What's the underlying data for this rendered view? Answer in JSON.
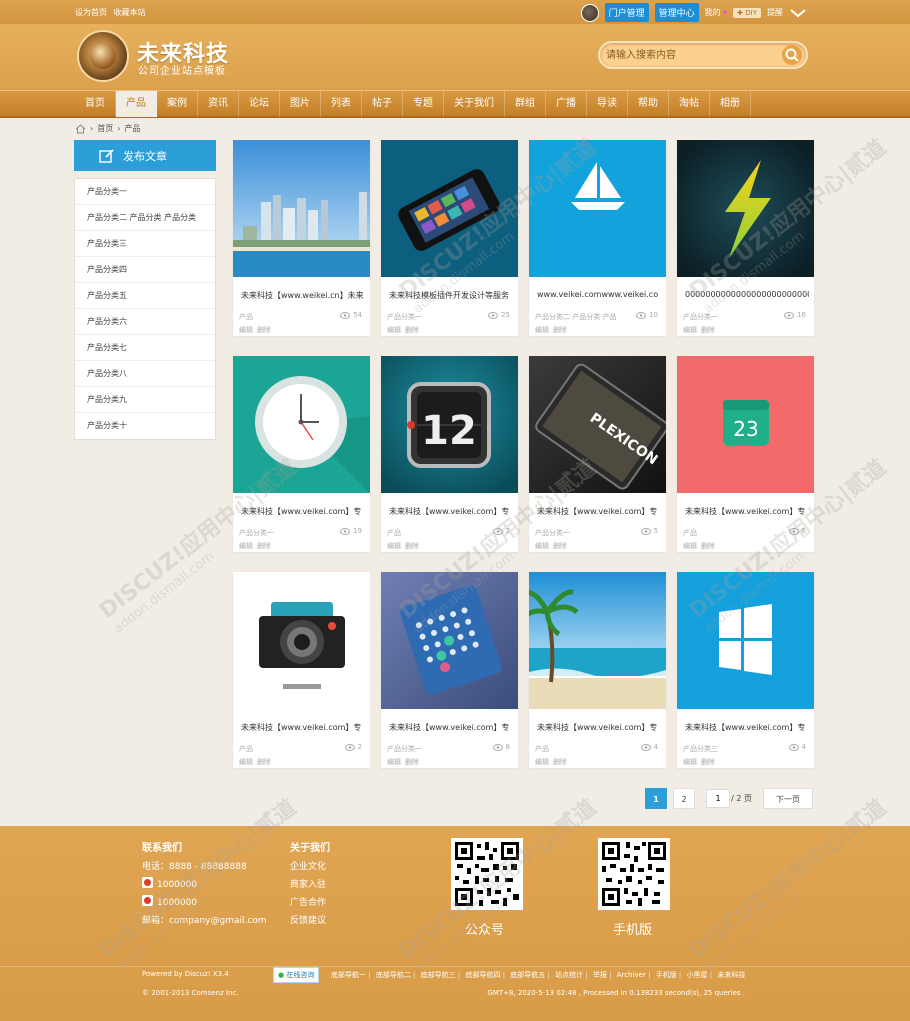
{
  "topbar": {
    "set_home": "设为首页",
    "bookmark": "收藏本站",
    "portal_admin": "门户管理",
    "admin_center": "管理中心",
    "mine": "我的",
    "diy": "DIY",
    "remind": "提醒"
  },
  "header": {
    "logo_title": "未来科技",
    "logo_subtitle": "公司企业站点模板",
    "search_placeholder": "请输入搜索内容"
  },
  "nav": [
    "首页",
    "产品",
    "案例",
    "资讯",
    "论坛",
    "图片",
    "列表",
    "帖子",
    "专题",
    "关于我们",
    "群组",
    "广播",
    "导读",
    "帮助",
    "淘帖",
    "相册"
  ],
  "breadcrumb": [
    "首页",
    "产品"
  ],
  "sidebar": {
    "publish_label": "发布文章",
    "categories": [
      "产品分类一",
      "产品分类二 产品分类 产品分类",
      "产品分类三",
      "产品分类四",
      "产品分类五",
      "产品分类六",
      "产品分类七",
      "产品分类八",
      "产品分类九",
      "产品分类十"
    ]
  },
  "cards": [
    {
      "title": "未来科技【www.weikei.cn】未来",
      "category": "产品",
      "views": "54",
      "edit": "编辑",
      "delete": "删除",
      "image": "city-skyline-image"
    },
    {
      "title": "未来科技模板插件开发设计等服务",
      "category": "产品分类一",
      "views": "25",
      "edit": "编辑",
      "delete": "删除",
      "image": "smartphone-image"
    },
    {
      "title": "www.veikei.comwww.veikei.co",
      "category": "产品分类二 产品分类 产品",
      "views": "10",
      "edit": "编辑",
      "delete": "删除",
      "image": "sailboat-image"
    },
    {
      "title": "000000000000000000000000000",
      "category": "产品分类一",
      "views": "16",
      "edit": "编辑",
      "delete": "删除",
      "image": "lightning-image"
    },
    {
      "title": "未来科技【www.veikei.com】专",
      "category": "产品分类一",
      "views": "19",
      "edit": "编辑",
      "delete": "删除",
      "image": "clock-image"
    },
    {
      "title": "未来科技【www.veikei.com】专",
      "category": "产品",
      "views": "2",
      "edit": "编辑",
      "delete": "删除",
      "image": "flip-clock-image"
    },
    {
      "title": "未来科技【www.veikei.com】专",
      "category": "产品分类一",
      "views": "5",
      "edit": "编辑",
      "delete": "删除",
      "image": "plexicon-tablet-image"
    },
    {
      "title": "未来科技【www.veikei.com】专",
      "category": "产品",
      "views": "6",
      "edit": "编辑",
      "delete": "删除",
      "image": "calendar-icon-image"
    },
    {
      "title": "未来科技【www.veikei.com】专",
      "category": "产品",
      "views": "2",
      "edit": "编辑",
      "delete": "删除",
      "image": "camera-image"
    },
    {
      "title": "未来科技【www.veikei.com】专",
      "category": "产品分类一",
      "views": "8",
      "edit": "编辑",
      "delete": "删除",
      "image": "calendar-app-image"
    },
    {
      "title": "未来科技【www.veikei.com】专",
      "category": "产品",
      "views": "4",
      "edit": "编辑",
      "delete": "删除",
      "image": "beach-image"
    },
    {
      "title": "未来科技【www.veikei.com】专",
      "category": "产品分类三",
      "views": "4",
      "edit": "编辑",
      "delete": "删除",
      "image": "windows-logo-image"
    }
  ],
  "pager": {
    "current": "1",
    "next_page": "2",
    "input_value": "1",
    "total": "/ 2 页",
    "next_label": "下一页"
  },
  "footer": {
    "contact_title": "联系我们",
    "phone": "电话：8888 - 88888888",
    "qq1": "1000000",
    "qq2": "1000000",
    "email": "邮箱：company@gmail.com",
    "about_title": "关于我们",
    "about_links": [
      "企业文化",
      "商家入驻",
      "广告合作",
      "反馈建议"
    ],
    "qr1_label": "公众号",
    "qr2_label": "手机版",
    "powered": "Powered by Discuz! X3.4",
    "copyright": "© 2001-2013 Comsenz Inc.",
    "online_consult": "在线咨询",
    "links": [
      "底部导航一",
      "底部导航二",
      "底部导航三",
      "底部导航四",
      "底部导航五",
      "站点统计",
      "举报",
      "Archiver",
      "手机版",
      "小黑屋",
      "未来科技"
    ],
    "stats": "GMT+8, 2020-5-13 02:48 , Processed in 0.138233 second(s), 25 queries ."
  },
  "watermark": {
    "brand": "DISCUZ!应用中心|贰道",
    "domain": "addon.dismall.com"
  }
}
